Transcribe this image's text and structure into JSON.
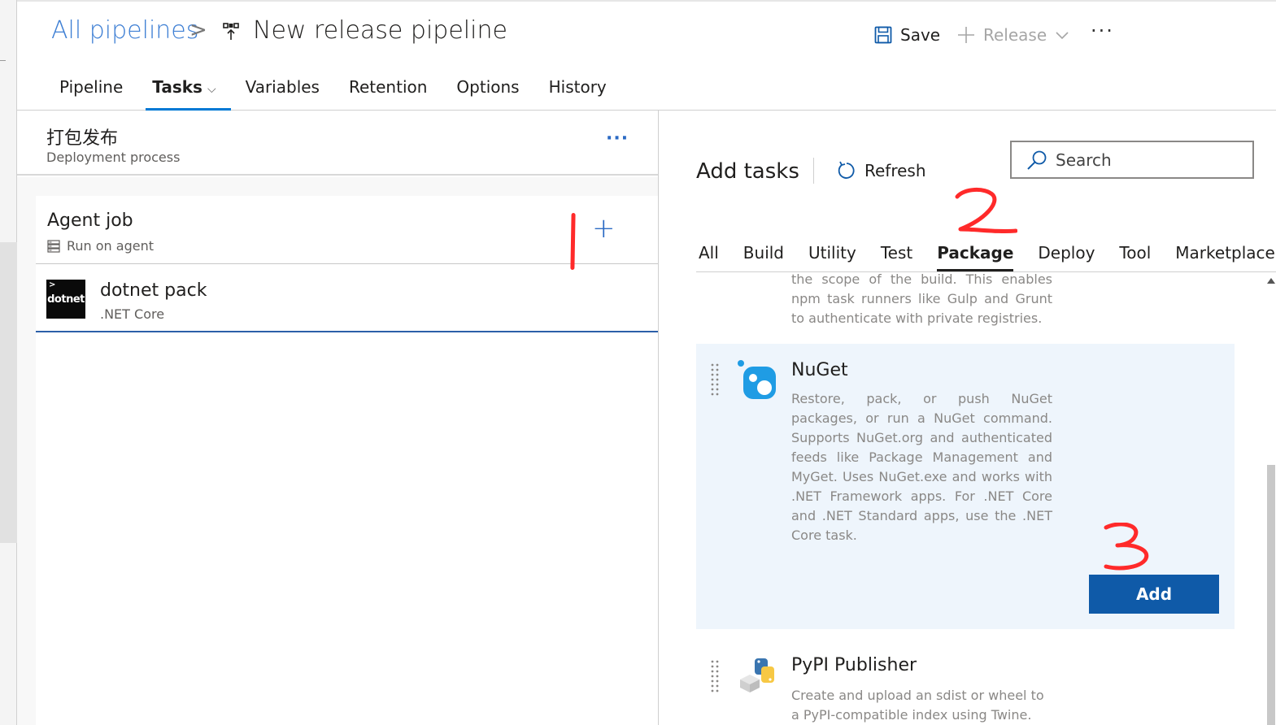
{
  "header": {
    "breadcrumb_root": "All pipelines",
    "breadcrumb_sep": ">",
    "title": "New release pipeline",
    "save_label": "Save",
    "release_label": "Release",
    "more": "···"
  },
  "tabs": [
    {
      "label": "Pipeline"
    },
    {
      "label": "Tasks",
      "active": true
    },
    {
      "label": "Variables"
    },
    {
      "label": "Retention"
    },
    {
      "label": "Options"
    },
    {
      "label": "History"
    }
  ],
  "stage": {
    "title": "打包发布",
    "subtitle": "Deployment process",
    "more": "···"
  },
  "agent_job": {
    "title": "Agent job",
    "subtitle": "Run on agent",
    "add": "+"
  },
  "task": {
    "icon_text": "dotnet",
    "icon_caret": ">",
    "title": "dotnet pack",
    "subtitle": ".NET Core"
  },
  "add_tasks": {
    "title": "Add tasks",
    "refresh_label": "Refresh",
    "search_placeholder": "Search",
    "categories": [
      {
        "label": "All"
      },
      {
        "label": "Build"
      },
      {
        "label": "Utility"
      },
      {
        "label": "Test"
      },
      {
        "label": "Package",
        "active": true
      },
      {
        "label": "Deploy"
      },
      {
        "label": "Tool"
      },
      {
        "label": "Marketplace"
      }
    ],
    "prev_desc": "the scope of the build. This enables npm task runners like Gulp and Grunt to authenticate with private registries.",
    "nuget": {
      "title": "NuGet",
      "desc": "Restore, pack, or push NuGet packages, or run a NuGet command. Supports NuGet.org and authenticated feeds like Package Management and MyGet. Uses NuGet.exe and works with .NET Framework apps. For .NET Core and .NET Standard apps, use the .NET Core task.",
      "add_label": "Add"
    },
    "pypi": {
      "title": "PyPI Publisher",
      "desc": "Create and upload an sdist or wheel to a PyPI-compatible index using Twine."
    }
  },
  "annotations": {
    "mark1": "1",
    "mark2": "2",
    "mark3": "3"
  },
  "colors": {
    "accent": "#0078d4",
    "link": "#3e7fd4",
    "add_button": "#0f5aa8",
    "card_bg": "#eef5fc",
    "annotation": "#ff2a2a"
  }
}
